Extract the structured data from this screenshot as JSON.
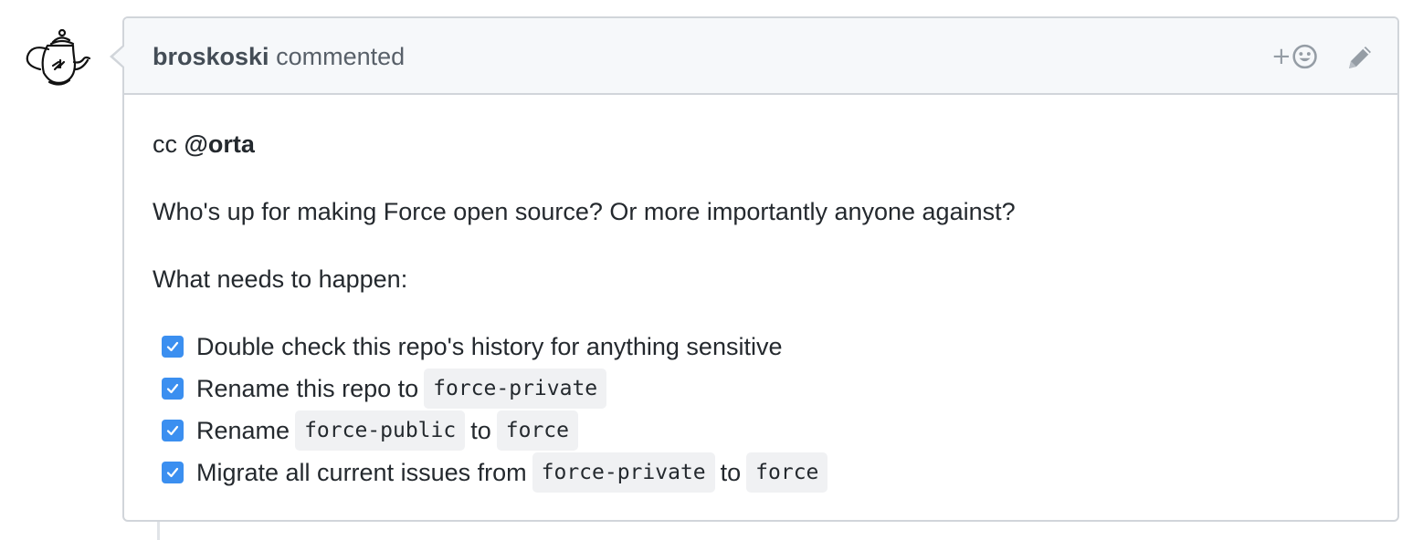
{
  "comment": {
    "author": "broskoski",
    "action": "commented",
    "mention_prefix": "cc ",
    "mention": "@orta",
    "paragraph1": "Who's up for making Force open source? Or more importantly anyone against?",
    "paragraph2": "What needs to happen:",
    "reaction_plus": "+",
    "tasks": [
      {
        "checked": true,
        "text1": "Double check this repo's history for anything sensitive"
      },
      {
        "checked": true,
        "text1": "Rename this repo to",
        "code1": "force-private"
      },
      {
        "checked": true,
        "text1": "Rename",
        "code1": "force-public",
        "text2": "to",
        "code2": "force"
      },
      {
        "checked": true,
        "text1": "Migrate all current issues from",
        "code1": "force-private",
        "text2": "to",
        "code2": "force"
      }
    ]
  },
  "colors": {
    "checkbox": "#3b8ff0",
    "border": "#d1d5da",
    "header_bg": "#f6f8fa",
    "code_bg": "#f0f1f3"
  },
  "icons": {
    "avatar": "teapot-avatar",
    "reaction": "smiley-icon",
    "edit": "pencil-icon"
  }
}
